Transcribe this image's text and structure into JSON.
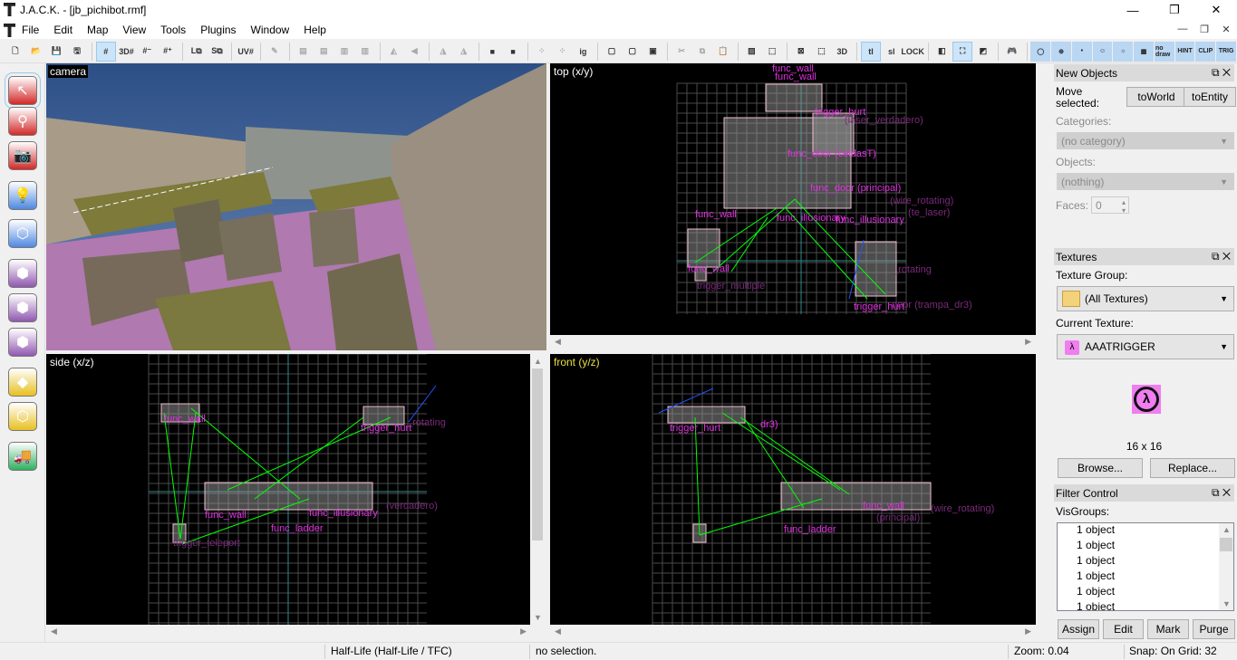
{
  "window": {
    "title": "J.A.C.K. - [jb_pichibot.rmf]",
    "controls": [
      "—",
      "❐",
      "✕"
    ],
    "mdi_controls": [
      "—",
      "❐",
      "✕"
    ]
  },
  "menu": [
    "File",
    "Edit",
    "Map",
    "View",
    "Tools",
    "Plugins",
    "Window",
    "Help"
  ],
  "toolbar": [
    {
      "icon": "new-file-icon",
      "g": "🗋"
    },
    {
      "icon": "open-file-icon",
      "g": "📂"
    },
    {
      "icon": "save-icon",
      "g": "💾"
    },
    {
      "icon": "save-as-icon",
      "g": "🖫"
    },
    "|",
    {
      "icon": "grid-icon",
      "g": "#",
      "on": true
    },
    {
      "icon": "3d-grid-icon",
      "g": "3D#"
    },
    {
      "icon": "grid-smaller-icon",
      "g": "#⁻"
    },
    {
      "icon": "grid-larger-icon",
      "g": "#⁺"
    },
    "|",
    {
      "icon": "load-window-state-icon",
      "g": "L⧉"
    },
    {
      "icon": "save-window-state-icon",
      "g": "S⧉"
    },
    "|",
    {
      "icon": "uv-grid-icon",
      "g": "UV#"
    },
    "|",
    {
      "icon": "carve-icon",
      "g": "✎",
      "dis": true
    },
    "|",
    {
      "icon": "align-left-icon",
      "g": "▤",
      "dis": true
    },
    {
      "icon": "align-right-icon",
      "g": "▤",
      "dis": true
    },
    {
      "icon": "align-top-icon",
      "g": "▥",
      "dis": true
    },
    {
      "icon": "align-bottom-icon",
      "g": "▥",
      "dis": true
    },
    "|",
    {
      "icon": "flip-horizontal-icon",
      "g": "◭",
      "dis": true
    },
    {
      "icon": "flip-vertical-icon",
      "g": "◀",
      "dis": true
    },
    "|",
    {
      "icon": "rotate-left-icon",
      "g": "◮",
      "dis": true
    },
    {
      "icon": "rotate-right-icon",
      "g": "◮",
      "dis": true
    },
    "|",
    {
      "icon": "hide-selected-icon",
      "g": "■"
    },
    {
      "icon": "show-all-icon",
      "g": "■"
    },
    "|",
    {
      "icon": "group-icon",
      "g": "⁘",
      "dis": true
    },
    {
      "icon": "ungroup-icon",
      "g": "⁘",
      "dis": true
    },
    {
      "icon": "ignore-groups-icon",
      "g": "ig"
    },
    "|",
    {
      "icon": "texture-lock-icon",
      "g": "▢"
    },
    {
      "icon": "hollow-icon",
      "g": "▢"
    },
    {
      "icon": "solid-icon",
      "g": "▣"
    },
    "|",
    {
      "icon": "cut-icon",
      "g": "✂",
      "dis": true
    },
    {
      "icon": "copy-icon",
      "g": "⧉",
      "dis": true
    },
    {
      "icon": "paste-icon",
      "g": "📋",
      "dis": true
    },
    "|",
    {
      "icon": "texture-application-icon",
      "g": "▨"
    },
    {
      "icon": "selection-box-icon",
      "g": "⬚"
    },
    "|",
    {
      "icon": "select-entities-icon",
      "g": "⊠"
    },
    {
      "icon": "select-by-box-icon",
      "g": "⬚"
    },
    {
      "icon": "select-3d-icon",
      "g": "3D"
    },
    "|",
    {
      "icon": "transform-tl-icon",
      "g": "tl",
      "on": true
    },
    {
      "icon": "transform-sl-icon",
      "g": "sl"
    },
    {
      "icon": "uv-lock-icon",
      "g": "LOCK"
    },
    "|",
    {
      "icon": "clip-plane-icon",
      "g": "◧"
    },
    {
      "icon": "vertex-edit-icon",
      "g": "⛶",
      "on": true
    },
    {
      "icon": "vertex-manipulation-icon",
      "g": "◩"
    },
    "|",
    {
      "icon": "run-map-icon",
      "g": "🎮"
    },
    "|"
  ],
  "texture_toolbar": [
    {
      "icon": "sky-icon",
      "g": "◯"
    },
    {
      "icon": "origin-icon",
      "g": "⊕"
    },
    {
      "icon": "bevel-icon",
      "g": "•"
    },
    {
      "icon": "player-icon",
      "g": "☺"
    },
    {
      "icon": "light-icon",
      "g": "☼"
    },
    {
      "icon": "film-icon",
      "g": "▦"
    },
    {
      "icon": "nodraw-icon",
      "g": "no draw"
    },
    {
      "icon": "hint-icon",
      "g": "HINT"
    },
    {
      "icon": "clip-icon",
      "g": "CLIP"
    },
    {
      "icon": "trigger-icon",
      "g": "TRIG"
    }
  ],
  "left_tools": [
    {
      "icon": "selection-tool-icon",
      "g": "↖",
      "color": "#d32828",
      "sel": true
    },
    {
      "icon": "magnify-tool-icon",
      "g": "⚲",
      "color": "#d32828"
    },
    {
      "icon": "camera-tool-icon",
      "g": "📷",
      "color": "#d32828"
    },
    {
      "icon": "entity-tool-icon",
      "g": "💡",
      "color": "#4f88e0"
    },
    {
      "icon": "block-tool-icon",
      "g": "⬡",
      "color": "#4f88e0"
    },
    {
      "icon": "texture-tool-icon",
      "g": "⬢",
      "color": "#9058b0"
    },
    {
      "icon": "apply-texture-icon",
      "g": "⬢",
      "color": "#9058b0"
    },
    {
      "icon": "decal-tool-icon",
      "g": "⬢",
      "color": "#9058b0"
    },
    {
      "icon": "clip-tool-icon",
      "g": "◆",
      "color": "#e8c020"
    },
    {
      "icon": "vertex-tool-icon",
      "g": "⬡",
      "color": "#e8c020"
    },
    {
      "icon": "path-tool-icon",
      "g": "🚚",
      "color": "#30b060"
    }
  ],
  "viewports": {
    "camera": "camera",
    "top": "top (x/y)",
    "side": "side (x/z)",
    "front": "front (y/z)",
    "top_labels": [
      "func_wall",
      "func_wall",
      "trigger_hurt",
      "(laser_verdadero)",
      "func_door (celdasT)",
      "func_door (principal)",
      "func_wall",
      "func_illusionary",
      "func_illusionary",
      "(wire_rotating)",
      "(te_laser)",
      "func_wall",
      "trigger_multiple",
      "_rotating",
      "trigger_hurt",
      "door (trampa_dr3)"
    ],
    "side_labels": [
      "func_wall",
      "trigger_hurt",
      "_rotating",
      "func_wall",
      "func_illusionary",
      "func_ladder",
      "trigger_teleport",
      "(verdadero)"
    ],
    "front_labels": [
      "trigger_hurt",
      "dr3)",
      "func_wall",
      "func_ladder",
      "(principal)",
      "(wire_rotating)"
    ]
  },
  "panels": {
    "new_objects": {
      "title": "New Objects",
      "move_selected": "Move selected:",
      "to_world": "toWorld",
      "to_entity": "toEntity",
      "categories_label": "Categories:",
      "categories_value": "(no category)",
      "objects_label": "Objects:",
      "objects_value": "(nothing)",
      "faces_label": "Faces:",
      "faces_value": "0"
    },
    "textures": {
      "title": "Textures",
      "group_label": "Texture Group:",
      "group_value": "(All Textures)",
      "current_label": "Current Texture:",
      "current_value": "AAATRIGGER",
      "size": "16 x 16",
      "browse": "Browse...",
      "replace": "Replace..."
    },
    "filter": {
      "title": "Filter Control",
      "visgroups_label": "VisGroups:",
      "items": [
        "1 object",
        "1 object",
        "1 object",
        "1 object",
        "1 object",
        "1 object"
      ],
      "assign": "Assign",
      "edit": "Edit",
      "mark": "Mark",
      "purge": "Purge"
    }
  },
  "status": {
    "game": "Half-Life (Half-Life / TFC)",
    "selection": "no selection.",
    "zoom": "Zoom: 0.04",
    "snap": "Snap: On Grid: 32"
  },
  "colors": {
    "accent": "#cce4f7",
    "entity_label": "#e030e0",
    "link_line": "#00ff00",
    "brush": "#ffffff",
    "grid": "#4a4a4a",
    "axis": "#2f8c8c"
  }
}
